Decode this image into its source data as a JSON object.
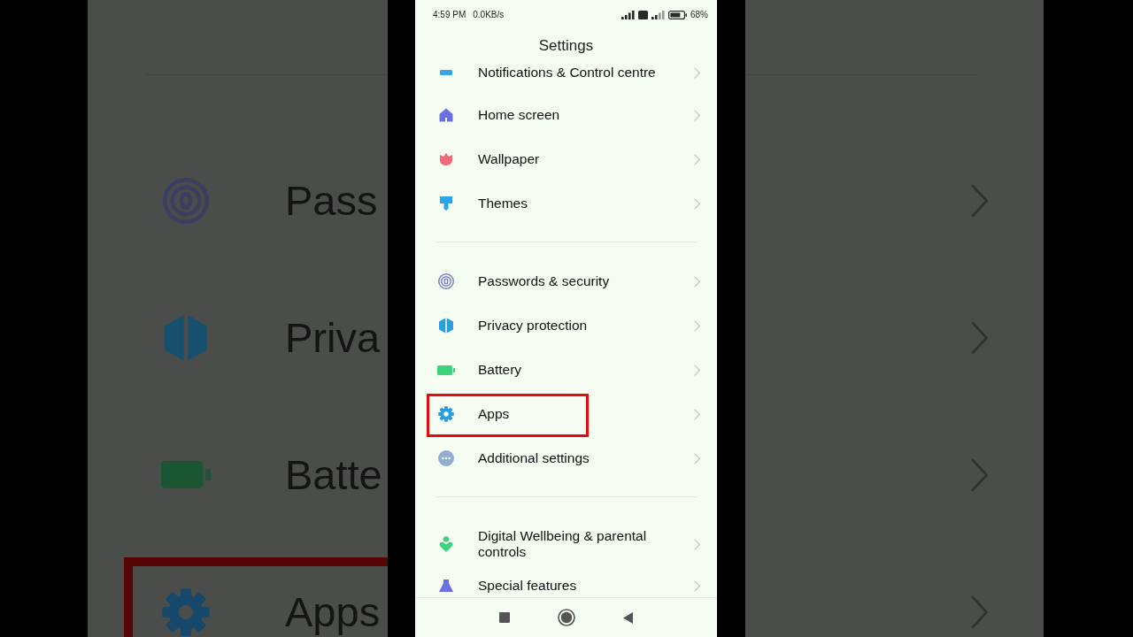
{
  "background": {
    "items": [
      {
        "label": "Pass",
        "highlighted": false
      },
      {
        "label": "Priva",
        "highlighted": false
      },
      {
        "label": "Batte",
        "highlighted": false
      },
      {
        "label": "Apps",
        "highlighted": true
      }
    ]
  },
  "screen": {
    "status_bar": {
      "time": "4:59 PM",
      "speed": "0.0KB/s",
      "battery": "68%"
    },
    "title": "Settings",
    "sections": [
      {
        "items": [
          {
            "label": "Notifications & Control centre",
            "highlighted": false
          },
          {
            "label": "Home screen",
            "highlighted": false
          },
          {
            "label": "Wallpaper",
            "highlighted": false
          },
          {
            "label": "Themes",
            "highlighted": false
          }
        ]
      },
      {
        "items": [
          {
            "label": "Passwords & security",
            "highlighted": false
          },
          {
            "label": "Privacy protection",
            "highlighted": false
          },
          {
            "label": "Battery",
            "highlighted": false
          },
          {
            "label": "Apps",
            "highlighted": true
          },
          {
            "label": "Additional settings",
            "highlighted": false
          }
        ]
      },
      {
        "items": [
          {
            "label": "Digital Wellbeing & parental controls",
            "highlighted": false
          },
          {
            "label": "Special features",
            "highlighted": false
          }
        ]
      }
    ]
  }
}
